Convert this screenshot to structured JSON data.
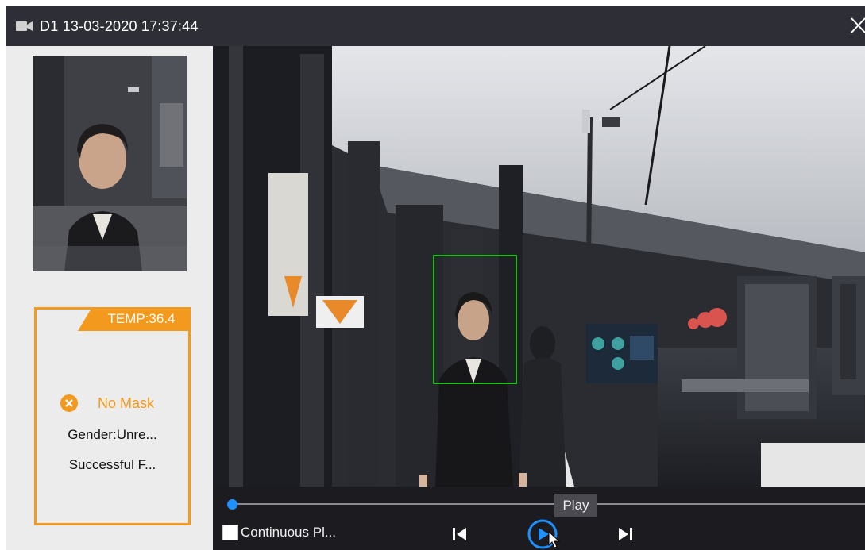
{
  "titlebar": {
    "camera_icon": "video-camera-icon",
    "title": "D1 13-03-2020 17:37:44",
    "close_icon": "close-icon"
  },
  "infocard": {
    "temp": "TEMP:36.4",
    "mask_icon": "x-circle-icon",
    "mask_status": "No Mask",
    "gender": "Gender:Unre...",
    "result": "Successful F..."
  },
  "controls": {
    "tooltip": "Play",
    "continuous_label": "Continuous Pl...",
    "progress": 0.0,
    "prev_icon": "skip-previous-icon",
    "play_icon": "play-icon",
    "next_icon": "skip-next-icon"
  },
  "colors": {
    "accent": "#f39a1e",
    "face_box": "#1fb81f",
    "progress": "#1e90ff",
    "titlebar": "#2e2e36"
  }
}
